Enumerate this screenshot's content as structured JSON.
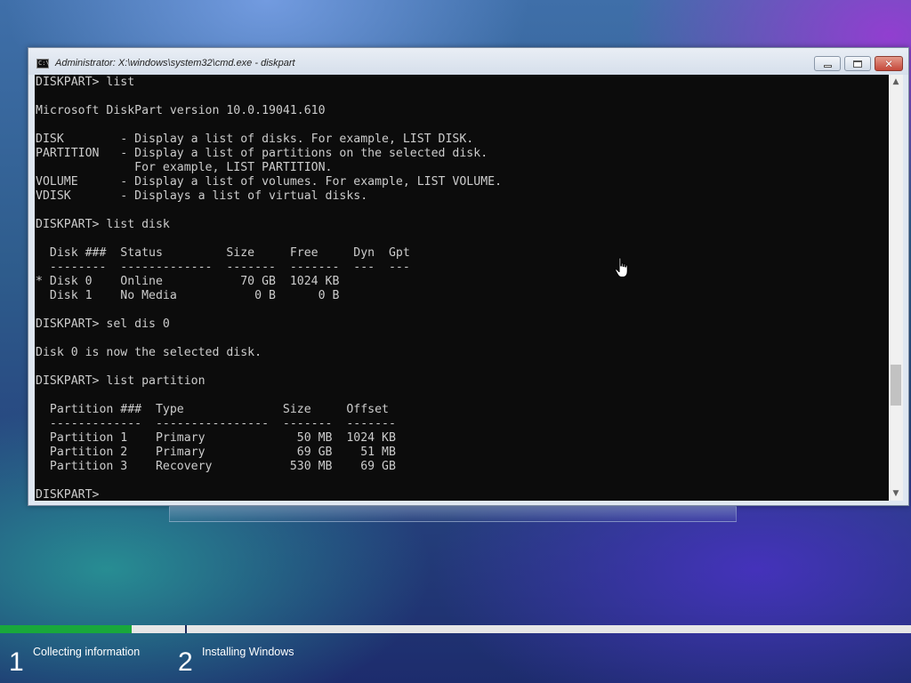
{
  "window": {
    "title": "Administrator: X:\\windows\\system32\\cmd.exe - diskpart",
    "icon_text": "C:\\",
    "controls": {
      "minimize": "minimize",
      "maximize": "maximize",
      "close": "✕"
    }
  },
  "console": {
    "lines": [
      "DISKPART> list",
      "",
      "Microsoft DiskPart version 10.0.19041.610",
      "",
      "DISK        - Display a list of disks. For example, LIST DISK.",
      "PARTITION   - Display a list of partitions on the selected disk.",
      "              For example, LIST PARTITION.",
      "VOLUME      - Display a list of volumes. For example, LIST VOLUME.",
      "VDISK       - Displays a list of virtual disks.",
      "",
      "DISKPART> list disk",
      "",
      "  Disk ###  Status         Size     Free     Dyn  Gpt",
      "  --------  -------------  -------  -------  ---  ---",
      "* Disk 0    Online           70 GB  1024 KB",
      "  Disk 1    No Media           0 B      0 B",
      "",
      "DISKPART> sel dis 0",
      "",
      "Disk 0 is now the selected disk.",
      "",
      "DISKPART> list partition",
      "",
      "  Partition ###  Type              Size     Offset",
      "  -------------  ----------------  -------  -------",
      "  Partition 1    Primary             50 MB  1024 KB",
      "  Partition 2    Primary             69 GB    51 MB",
      "  Partition 3    Recovery           530 MB    69 GB",
      "",
      "DISKPART> "
    ]
  },
  "scrollbar": {
    "up_arrow": "▲",
    "down_arrow": "▼"
  },
  "setup": {
    "progress_fraction": 0.145,
    "progress_color": "#19a83b",
    "steps": [
      {
        "number": "1",
        "label": "Collecting information"
      },
      {
        "number": "2",
        "label": "Installing Windows"
      }
    ]
  }
}
